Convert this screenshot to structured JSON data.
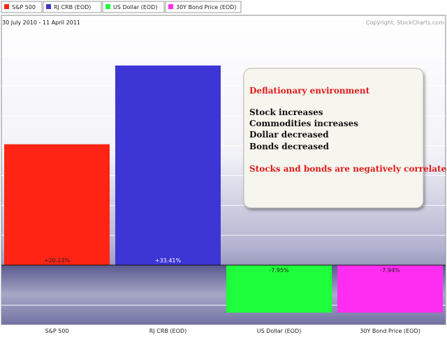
{
  "chart_data": {
    "type": "bar",
    "date_range": "30 July 2010 - 11 April 2011",
    "copyright": "Copyright, StockCharts.com",
    "categories": [
      "S&P 500",
      "RJ CRB (EOD)",
      "US Dollar (EOD)",
      "30Y Bond Price (EOD)"
    ],
    "values": [
      20.23,
      33.41,
      -7.95,
      -7.94
    ],
    "value_labels": [
      "+20.23%",
      "+33.41%",
      "-7.95%",
      "-7.94%"
    ],
    "colors": [
      "#ff2414",
      "#3d35d4",
      "#1cff3a",
      "#ff2cf2"
    ],
    "ylim": [
      -9.5,
      39
    ],
    "grid": true,
    "legend": {
      "placement": "top-left",
      "items": [
        "S&P 500",
        "RJ CRB (EOD)",
        "US Dollar (EOD)",
        "30Y Bond Price (EOD)"
      ]
    },
    "annotation": {
      "title": "Deflationary environment",
      "lines": [
        "Stock increases",
        "Commodities increases",
        "Dollar decreased",
        "Bonds decreased"
      ],
      "conclusion": "Stocks and bonds are negatively correlated"
    }
  },
  "colors": {
    "annotation_red": "#e01b1b",
    "annotation_black": "#111111",
    "annotation_bg": "#f6f5ee"
  }
}
